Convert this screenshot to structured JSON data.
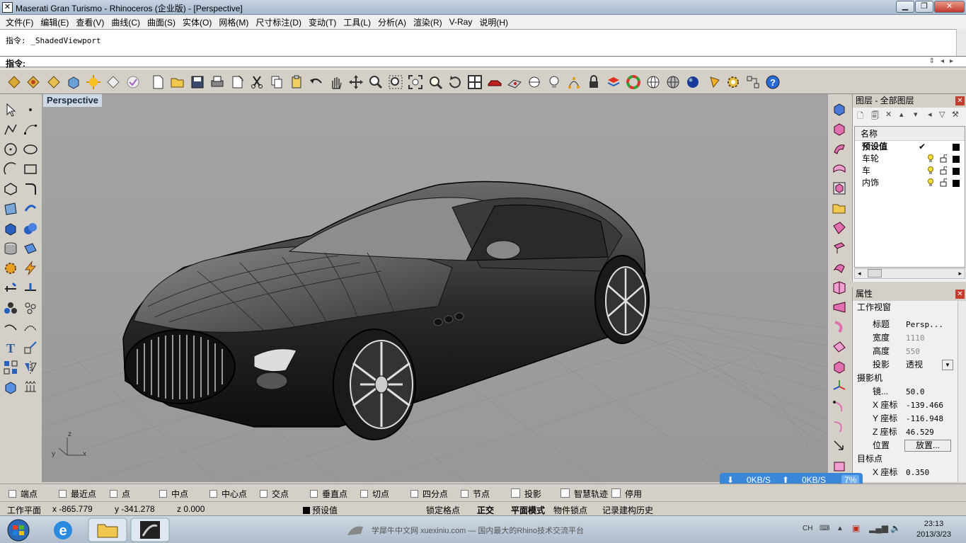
{
  "window": {
    "title": "Maserati Gran Turismo - Rhinoceros (企业版) - [Perspective]"
  },
  "menu": [
    "文件(F)",
    "编辑(E)",
    "查看(V)",
    "曲线(C)",
    "曲面(S)",
    "实体(O)",
    "网格(M)",
    "尺寸标注(D)",
    "变动(T)",
    "工具(L)",
    "分析(A)",
    "渲染(R)",
    "V-Ray",
    "说明(H)"
  ],
  "command": {
    "history": "指令: _ShadedViewport",
    "prompt_label": "指令:",
    "value": ""
  },
  "viewport": {
    "label": "Perspective",
    "axes": {
      "x": "x",
      "y": "y",
      "z": "z"
    }
  },
  "layers": {
    "title": "图层 - 全部图层",
    "column": "名称",
    "rows": [
      {
        "name": "预设值",
        "current": true,
        "check": "✔"
      },
      {
        "name": "车轮"
      },
      {
        "name": "车"
      },
      {
        "name": "内饰"
      }
    ]
  },
  "properties": {
    "title": "属性",
    "section_viewport": "工作视窗",
    "title_key": "标题",
    "title_val": "Persp...",
    "width_key": "宽度",
    "width_val": "1110",
    "height_key": "高度",
    "height_val": "550",
    "proj_key": "投影",
    "proj_val": "透视",
    "section_camera": "摄影机",
    "lens_key": "镜...",
    "lens_val": "50.0",
    "cx_key": "X 座标",
    "cx_val": "-139.466",
    "cy_key": "Y 座标",
    "cy_val": "-116.948",
    "cz_key": "Z 座标",
    "cz_val": "46.529",
    "pos_key": "位置",
    "pos_btn": "放置...",
    "section_target": "目标点",
    "tx_key": "X 座标",
    "tx_val": "0.350"
  },
  "network": {
    "down": "0KB/S",
    "up": "0KB/S",
    "pct": "7%"
  },
  "osnap": [
    "端点",
    "最近点",
    "点",
    "中点",
    "中心点",
    "交点",
    "垂直点",
    "切点",
    "四分点",
    "节点",
    "投影",
    "智慧轨迹",
    "停用"
  ],
  "status": {
    "cplane": "工作平面",
    "x": "x -865.779",
    "y": "y -341.278",
    "z": "z 0.000",
    "layer": "预设值",
    "grid_snap": "锁定格点",
    "ortho": "正交",
    "planar": "平面模式",
    "osnap": "物件锁点",
    "history": "记录建构历史"
  },
  "taskbar": {
    "center": "学犀牛中文网 xuexiniu.com — 国内最大的Rhino技术交流平台",
    "lang": "CH",
    "time": "23:13",
    "date": "2013/3/23"
  },
  "colors": {
    "viewport_bg": "#a2a2a2",
    "accent": "#3a86d8"
  }
}
